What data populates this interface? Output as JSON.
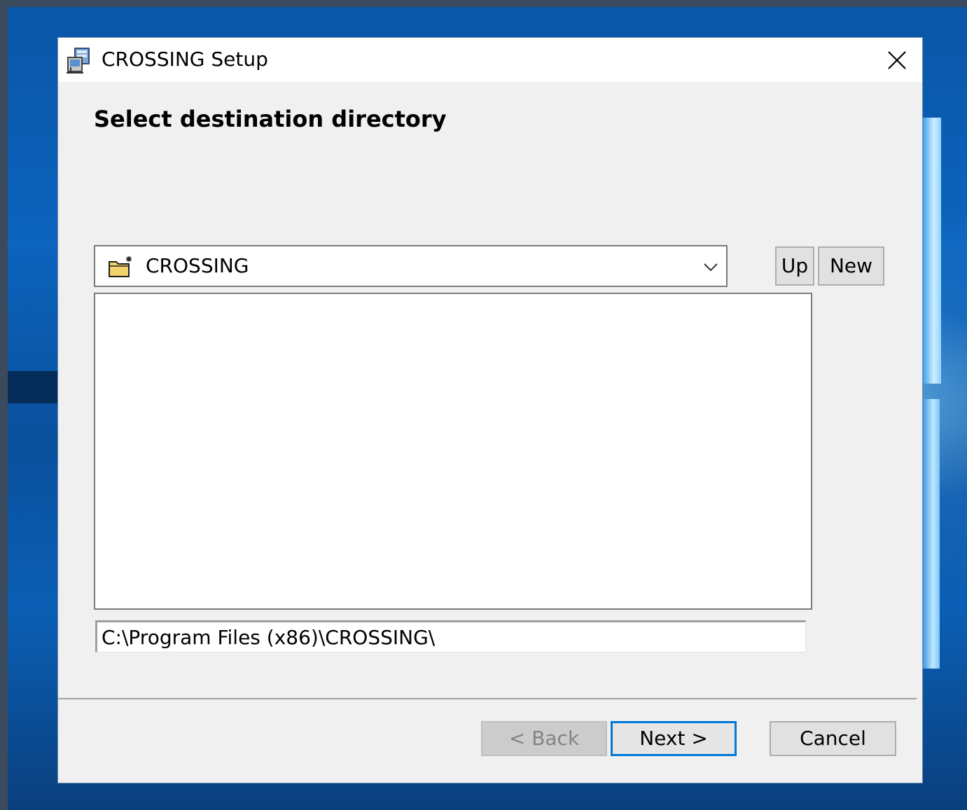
{
  "window": {
    "title": "CROSSING Setup",
    "heading": "Select destination directory"
  },
  "folder_combo": {
    "selected": "CROSSING",
    "icon": "new-folder-icon"
  },
  "toolbar": {
    "up_label": "Up",
    "new_label": "New"
  },
  "folder_list": {
    "items": []
  },
  "path": {
    "value": "C:\\Program Files (x86)\\CROSSING\\"
  },
  "footer": {
    "back_label": "< Back",
    "next_label": "Next >",
    "cancel_label": "Cancel"
  },
  "colors": {
    "focus_border": "#0078d7",
    "dialog_bg": "#f0f0f0",
    "disabled_text": "#838383"
  }
}
